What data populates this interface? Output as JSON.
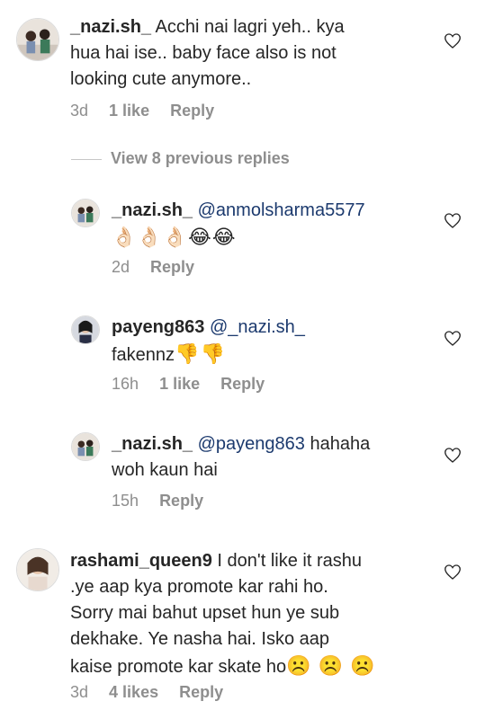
{
  "comments": [
    {
      "username": "_nazi.sh_",
      "mention": "",
      "text_line1": "Acchi nai lagri yeh.. kya",
      "text_line2": "hua hai ise.. baby face also is not",
      "text_line3": "looking cute anymore..",
      "time": "3d",
      "likes": "1 like",
      "reply": "Reply"
    }
  ],
  "view_replies_label": "View 8 previous replies",
  "replies": [
    {
      "username": "_nazi.sh_",
      "mention": "@anmolsharma5577",
      "emojis": "👌🏻👌🏻👌🏻😂😂",
      "time": "2d",
      "reply": "Reply"
    },
    {
      "username": "payeng863",
      "mention": "@_nazi.sh_",
      "text": "fakennz",
      "emojis": "👎👎",
      "time": "16h",
      "likes": "1 like",
      "reply": "Reply"
    },
    {
      "username": "_nazi.sh_",
      "mention": "@payeng863",
      "text_inline": "hahaha",
      "text_line2": "woh kaun hai",
      "time": "15h",
      "reply": "Reply"
    }
  ],
  "comment2": {
    "username": "rashami_queen9",
    "text_line1": "I don't like it rashu",
    "text_line2": ".ye aap kya promote kar rahi ho.",
    "text_line3": "Sorry mai bahut upset hun ye sub",
    "text_line4": "dekhake. Ye nasha hai. Isko aap",
    "text_line5": "kaise promote kar skate ho",
    "emojis": "☹️ ☹️ ☹️",
    "time": "3d",
    "likes": "4 likes",
    "reply": "Reply"
  }
}
